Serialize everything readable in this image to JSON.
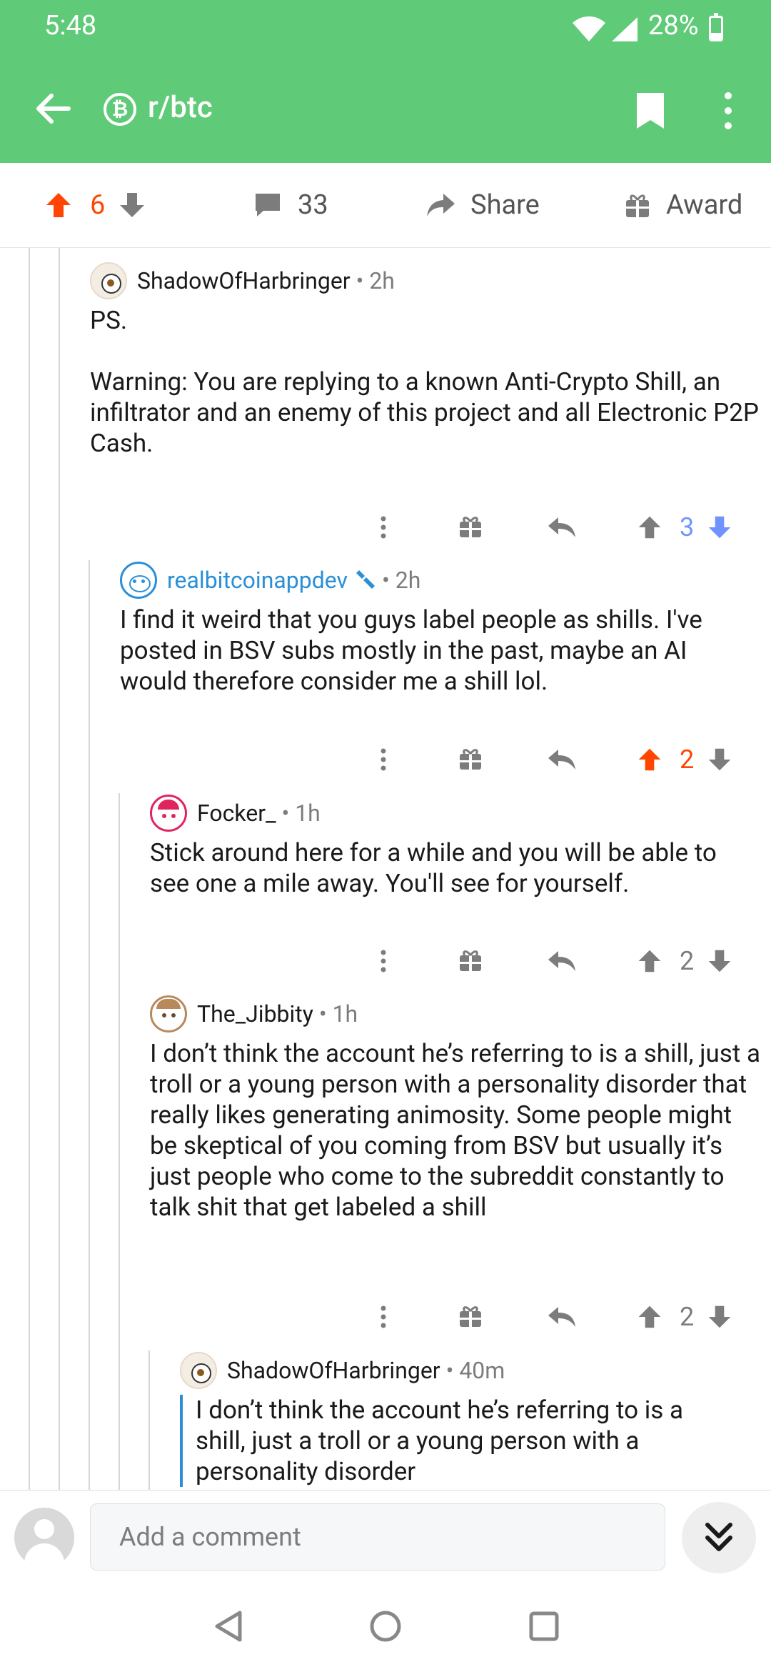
{
  "status": {
    "time": "5:48",
    "battery": "28%"
  },
  "appbar": {
    "subreddit": "r/btc"
  },
  "post_actions": {
    "score": "6",
    "comments": "33",
    "share": "Share",
    "award": "Award"
  },
  "comments": [
    {
      "user": "ShadowOfHarbringer",
      "age": "2h",
      "body1": "PS.",
      "body2": "Warning: You are replying to a known Anti-Crypto Shill, an infiltrator and an enemy of this project and all Electronic P2P Cash.",
      "score": "3",
      "vote_state": "down"
    },
    {
      "user": "realbitcoinappdev",
      "age": "2h",
      "body": "I find it weird that you guys label people as shills. I've posted in BSV subs mostly in the past, maybe an AI would therefore consider me a shill lol.",
      "score": "2",
      "vote_state": "up"
    },
    {
      "user": "Focker_",
      "age": "1h",
      "body": "Stick around here for a while and you will be able to see one a mile away. You'll see for yourself.",
      "score": "2",
      "vote_state": "none"
    },
    {
      "user": "The_Jibbity",
      "age": "1h",
      "body": "I don’t think the account he’s referring to is a shill, just a troll or a young person with a personality disorder that really likes generating animosity. Some people might be skeptical of you coming from BSV but usually it’s just people who come to the subreddit constantly to talk shit that get labeled a shill",
      "score": "2",
      "vote_state": "none"
    },
    {
      "user": "ShadowOfHarbringer",
      "age": "40m",
      "quote": "I don’t think the account he’s referring to is a shill, just a troll or a young person with a personality disorder"
    }
  ],
  "composer": {
    "placeholder": "Add a comment"
  },
  "colors": {
    "header": "#5fca77",
    "upvote": "#ff4500",
    "downvote": "#7193ff",
    "op": "#2a8fd6"
  }
}
